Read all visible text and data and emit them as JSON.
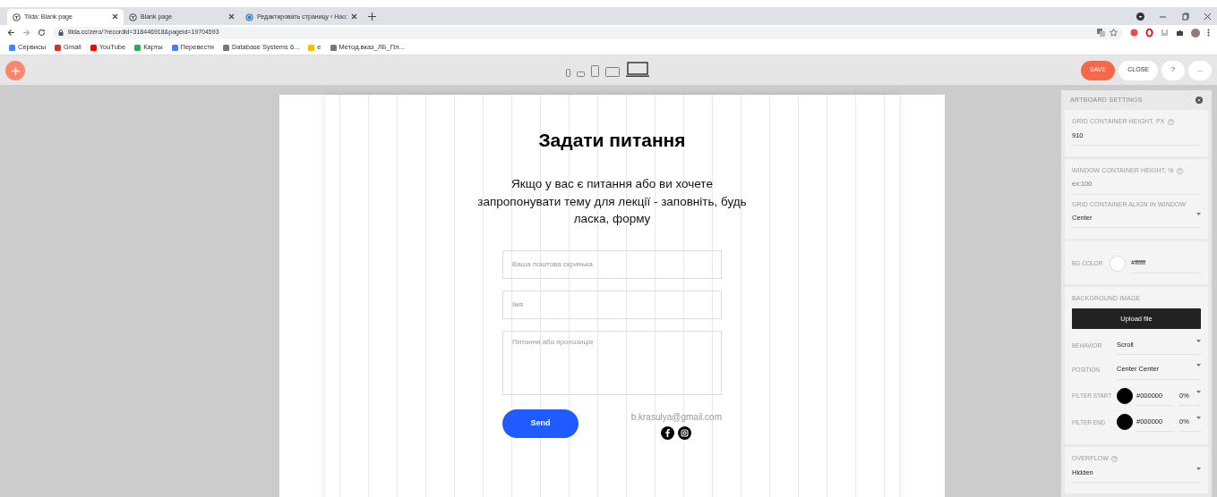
{
  "browser": {
    "tabs": [
      {
        "title": "Tilda: Blank page",
        "selected": true
      },
      {
        "title": "Blank page",
        "selected": false
      },
      {
        "title": "Редактировать страницу ‹ Нао:",
        "selected": false
      }
    ],
    "url": "tilda.cc/zero/?recordid=318446918&pageid=19704593",
    "bookmarks": [
      {
        "label": "Сервисы",
        "color": "#4285f4"
      },
      {
        "label": "Gmail",
        "color": "#d93025"
      },
      {
        "label": "YouTube",
        "color": "#ff0000"
      },
      {
        "label": "Карты",
        "color": "#34a853"
      },
      {
        "label": "Перевести",
        "color": "#4a7ef0"
      },
      {
        "label": "Database Systems 6...",
        "color": "#777777"
      },
      {
        "label": "e",
        "color": "#fbbc04"
      },
      {
        "label": "Метод.вказ_ЛБ_Пл...",
        "color": "#777777"
      }
    ]
  },
  "toolbar": {
    "devices": [
      {
        "selected": false
      },
      {
        "selected": false
      },
      {
        "selected": false
      },
      {
        "selected": false
      },
      {
        "selected": true
      }
    ],
    "buttons": [
      {
        "label": "SAVE",
        "kind": "primary"
      },
      {
        "label": "CLOSE",
        "kind": "plain"
      },
      {
        "label": "?",
        "kind": "round"
      },
      {
        "label": "...",
        "kind": "round"
      }
    ]
  },
  "form": {
    "title": "Задати питання",
    "description": "Якщо у вас є питання або ви хочете запропонувати тему для лекції - заповніть, будь ласка, форму",
    "fields": [
      {
        "kind": "input",
        "placeholder": "Ваша поштова скринька"
      },
      {
        "kind": "input",
        "placeholder": "Імя"
      },
      {
        "kind": "textarea",
        "placeholder": "Питання або пропозиція"
      }
    ],
    "button": "Send",
    "email": "b.krasulya@gmail.com"
  },
  "panel": {
    "title": "ARTBOARD SETTINGS",
    "sections": [
      {
        "fields": [
          {
            "kind": "text",
            "label": "GRID CONTAINER HEIGHT, PX",
            "help": true,
            "value": "910"
          }
        ]
      },
      {
        "fields": [
          {
            "kind": "text",
            "label": "WINDOW CONTAINER HEIGHT, %",
            "help": true,
            "placeholder": "ex:100"
          },
          {
            "kind": "select",
            "label": "GRID CONTAINER ALIGN IN WINDOW",
            "help": false,
            "value": "Center"
          }
        ]
      },
      {
        "fields": [
          {
            "kind": "color",
            "label": "BG COLOR",
            "color": "#ffffff",
            "value": "#ffffff"
          }
        ]
      },
      {
        "fields": [
          {
            "kind": "heading",
            "label": "BACKGROUND IMAGE"
          },
          {
            "kind": "button",
            "label": "Upload file"
          },
          {
            "kind": "inline-select",
            "label": "BEHAVIOR",
            "value": "Scroll"
          },
          {
            "kind": "inline-select",
            "label": "POSITION",
            "value": "Center Center"
          },
          {
            "kind": "filter",
            "label": "FILTER START",
            "color": "#000000",
            "value": "#000000",
            "percent": "0%"
          },
          {
            "kind": "filter",
            "label": "FILTER END",
            "color": "#000000",
            "value": "#000000",
            "percent": "0%"
          }
        ]
      },
      {
        "fields": [
          {
            "kind": "select",
            "label": "OVERFLOW",
            "help": true,
            "value": "Hidden"
          }
        ]
      }
    ]
  }
}
